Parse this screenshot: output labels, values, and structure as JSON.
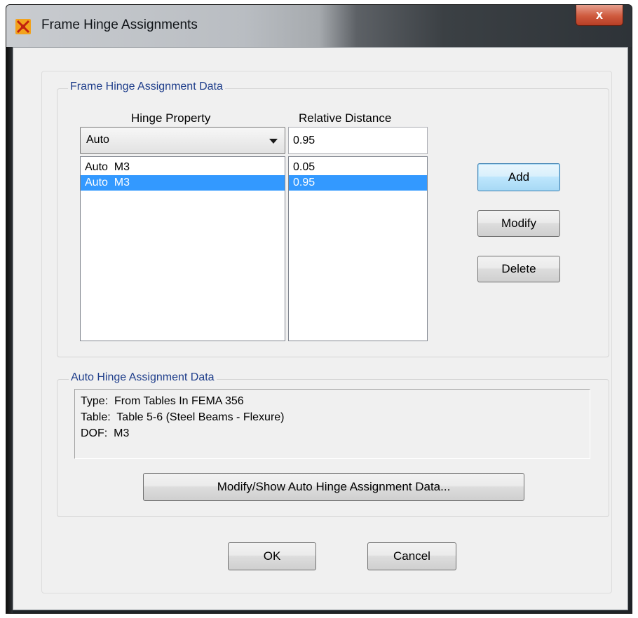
{
  "window": {
    "title": "Frame Hinge Assignments",
    "close_label": "x"
  },
  "frame_group": {
    "legend": "Frame Hinge Assignment Data",
    "hinge_property_header": "Hinge Property",
    "relative_distance_header": "Relative Distance",
    "hinge_property_selected": "Auto",
    "relative_distance_value": "0.95",
    "hinge_list": [
      {
        "label": "Auto  M3",
        "selected": false
      },
      {
        "label": "Auto  M3",
        "selected": true
      }
    ],
    "distance_list": [
      {
        "label": "0.05",
        "selected": false
      },
      {
        "label": "0.95",
        "selected": true
      }
    ],
    "add_label": "Add",
    "modify_label": "Modify",
    "delete_label": "Delete"
  },
  "auto_group": {
    "legend": "Auto Hinge Assignment Data",
    "lines": [
      "Type:  From Tables In FEMA 356",
      "Table:  Table 5-6 (Steel Beams - Flexure)",
      "DOF:  M3"
    ],
    "modify_show_label": "Modify/Show Auto Hinge Assignment Data..."
  },
  "footer": {
    "ok_label": "OK",
    "cancel_label": "Cancel"
  },
  "colors": {
    "selection": "#3399ff",
    "legend_text": "#1f3e8b",
    "dialog_bg": "#f0f0f0",
    "close_button": "#cf5a3e"
  }
}
